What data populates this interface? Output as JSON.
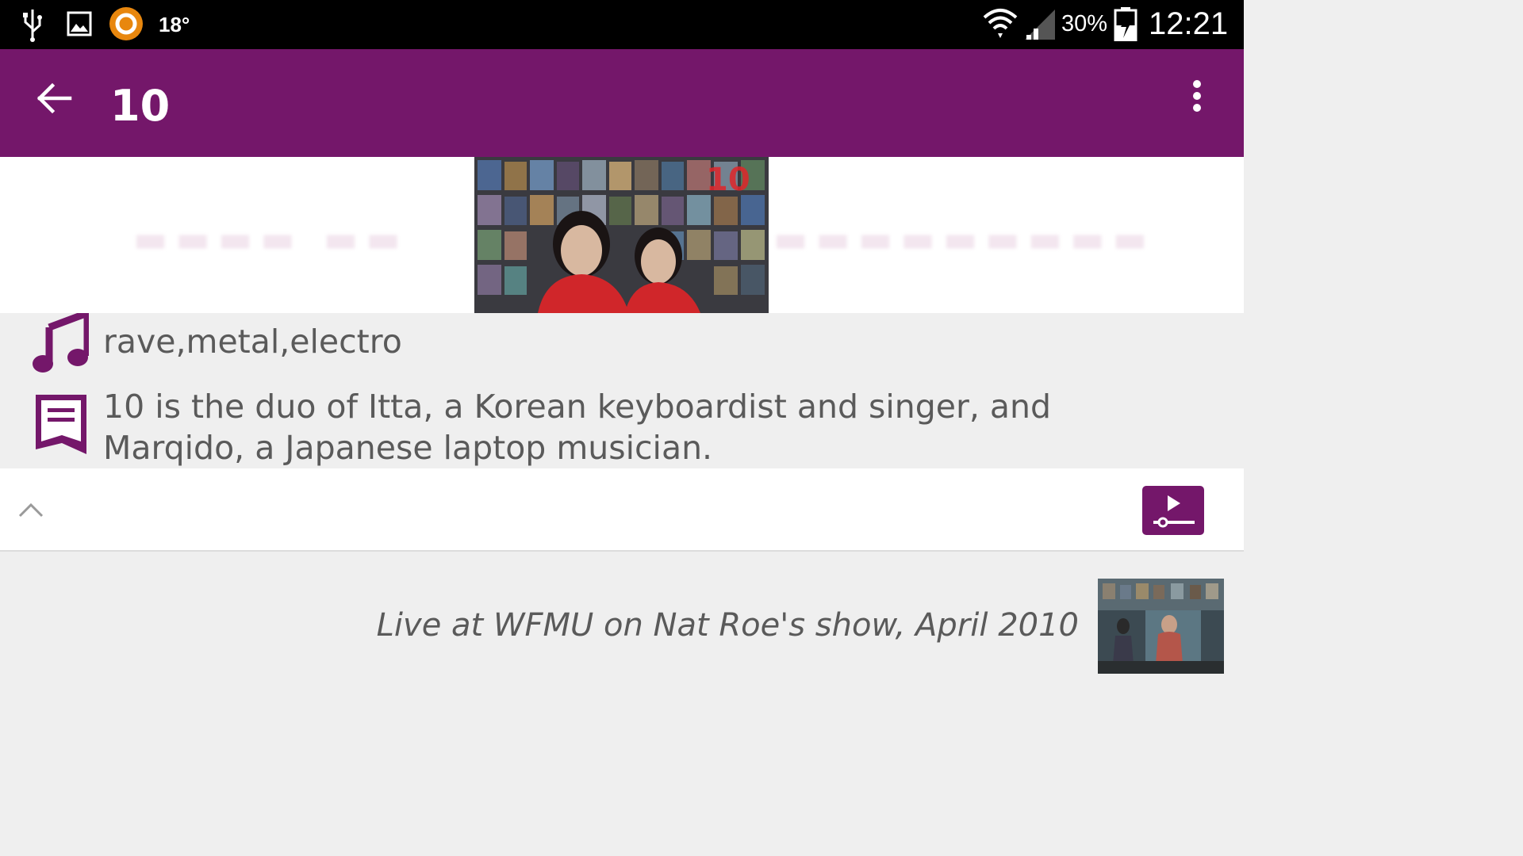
{
  "status_bar": {
    "temperature": "18°",
    "battery": "30%",
    "time": "12:21",
    "icons": [
      "usb-icon",
      "gallery-icon",
      "weather-app-icon",
      "wifi-icon",
      "signal-icon",
      "battery-charging-icon"
    ]
  },
  "app_bar": {
    "title": "10",
    "background": "#74176a"
  },
  "artist": {
    "genres": "rave,metal,electro",
    "description": "10 is the duo of Itta, a Korean keyboardist and singer, and Marqido, a Japanese laptop musician."
  },
  "track": {
    "caption": "Live at WFMU on Nat Roe's show, April 2010"
  },
  "colors": {
    "accent": "#74176a",
    "text": "#5a5a5a",
    "panel": "#efefef"
  }
}
